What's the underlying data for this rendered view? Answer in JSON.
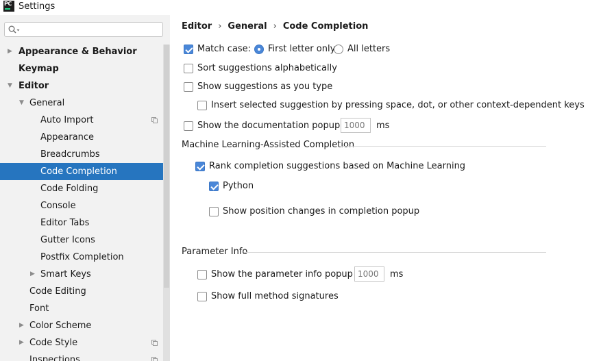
{
  "window": {
    "title": "Settings",
    "logo_text": "PC"
  },
  "search": {
    "placeholder": "",
    "value": ""
  },
  "sidebar": {
    "items": [
      {
        "label": "Appearance & Behavior"
      },
      {
        "label": "Keymap"
      },
      {
        "label": "Editor"
      },
      {
        "label": "General"
      },
      {
        "label": "Auto Import"
      },
      {
        "label": "Appearance"
      },
      {
        "label": "Breadcrumbs"
      },
      {
        "label": "Code Completion"
      },
      {
        "label": "Code Folding"
      },
      {
        "label": "Console"
      },
      {
        "label": "Editor Tabs"
      },
      {
        "label": "Gutter Icons"
      },
      {
        "label": "Postfix Completion"
      },
      {
        "label": "Smart Keys"
      },
      {
        "label": "Code Editing"
      },
      {
        "label": "Font"
      },
      {
        "label": "Color Scheme"
      },
      {
        "label": "Code Style"
      },
      {
        "label": "Inspections"
      }
    ],
    "selected": "Code Completion"
  },
  "breadcrumb": {
    "items": [
      "Editor",
      "General",
      "Code Completion"
    ],
    "separator": "›"
  },
  "settings": {
    "match_case": {
      "label": "Match case:",
      "checked": true
    },
    "first_letter_only": {
      "label": "First letter only",
      "selected": true
    },
    "all_letters": {
      "label": "All letters",
      "selected": false
    },
    "sort_alpha": {
      "label": "Sort suggestions alphabetically",
      "checked": false
    },
    "show_as_type": {
      "label": "Show suggestions as you type",
      "checked": false
    },
    "insert_selected": {
      "label": "Insert selected suggestion by pressing space, dot, or other context-dependent keys",
      "checked": false
    },
    "doc_popup": {
      "label": "Show the documentation popup in",
      "value": "1000",
      "unit": "ms",
      "checked": false
    }
  },
  "ml_section": {
    "title": "Machine Learning-Assisted Completion",
    "rank": {
      "label": "Rank completion suggestions based on Machine Learning",
      "checked": true
    },
    "python": {
      "label": "Python",
      "checked": true
    },
    "position_changes": {
      "label": "Show position changes in completion popup",
      "checked": false
    }
  },
  "param_section": {
    "title": "Parameter Info",
    "param_popup": {
      "label": "Show the parameter info popup in",
      "value": "1000",
      "unit": "ms",
      "checked": false
    },
    "full_signatures": {
      "label": "Show full method signatures",
      "checked": false
    }
  },
  "colors": {
    "accent": "#2675bf",
    "checkbox": "#4a87d8",
    "sidebar_bg": "#f2f2f2"
  }
}
